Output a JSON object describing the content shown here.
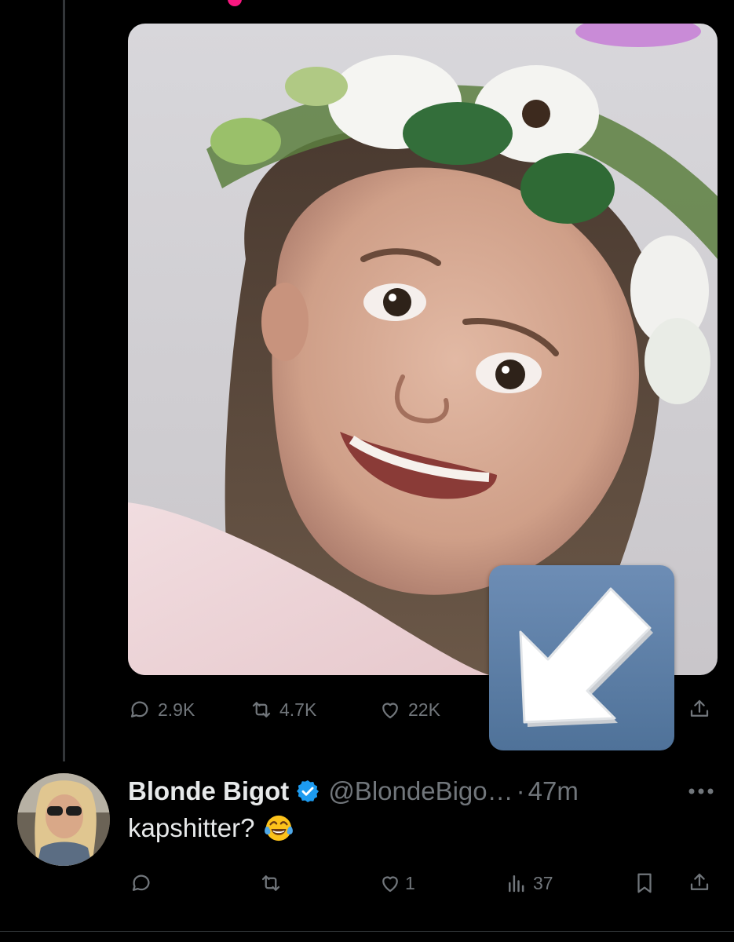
{
  "tweet": {
    "metrics": {
      "replies": "2.9K",
      "reposts": "4.7K",
      "likes": "22K"
    },
    "media": {
      "description_icon": "photo-of-smiling-child-with-flower-crown"
    }
  },
  "sticker": {
    "icon": "down-left-arrow-emoji"
  },
  "reply": {
    "display_name": "Blonde Bigot",
    "handle": "@BlondeBigo…",
    "separator": "·",
    "time": "47m",
    "text": "kapshitter?",
    "emoji": "face-with-tears-of-joy",
    "metrics": {
      "replies": "",
      "reposts": "",
      "likes": "1",
      "views": "37"
    }
  },
  "colors": {
    "background": "#000000",
    "text_primary": "#e7e9ea",
    "text_secondary": "#71767b",
    "verified_blue": "#1d9bf0",
    "thread_line": "#333639"
  }
}
